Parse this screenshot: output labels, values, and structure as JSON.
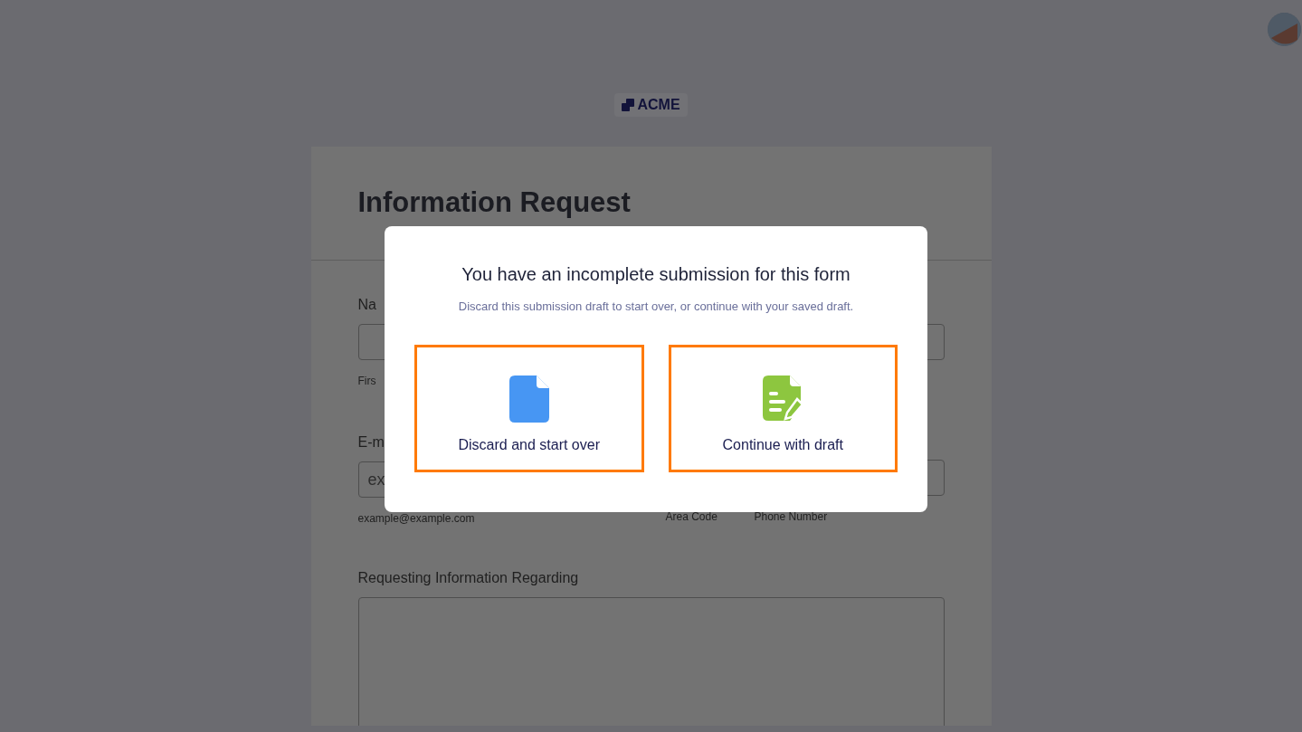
{
  "logo": {
    "text": "ACME"
  },
  "form": {
    "title": "Information Request",
    "name_field": {
      "label": "Na",
      "sublabel": "Firs"
    },
    "email_field": {
      "label": "E-m",
      "placeholder": "ex",
      "sublabel": "example@example.com"
    },
    "phone_field": {
      "sublabels": [
        "Area Code",
        "Phone Number"
      ]
    },
    "request_field": {
      "label": "Requesting Information Regarding"
    }
  },
  "dialog": {
    "title": "You have an incomplete submission for this form",
    "message": "Discard this submission draft to start over, or continue with your saved draft.",
    "options": [
      {
        "kind": "discard",
        "label": "Discard and start over"
      },
      {
        "kind": "continue",
        "label": "Continue with draft"
      }
    ]
  }
}
